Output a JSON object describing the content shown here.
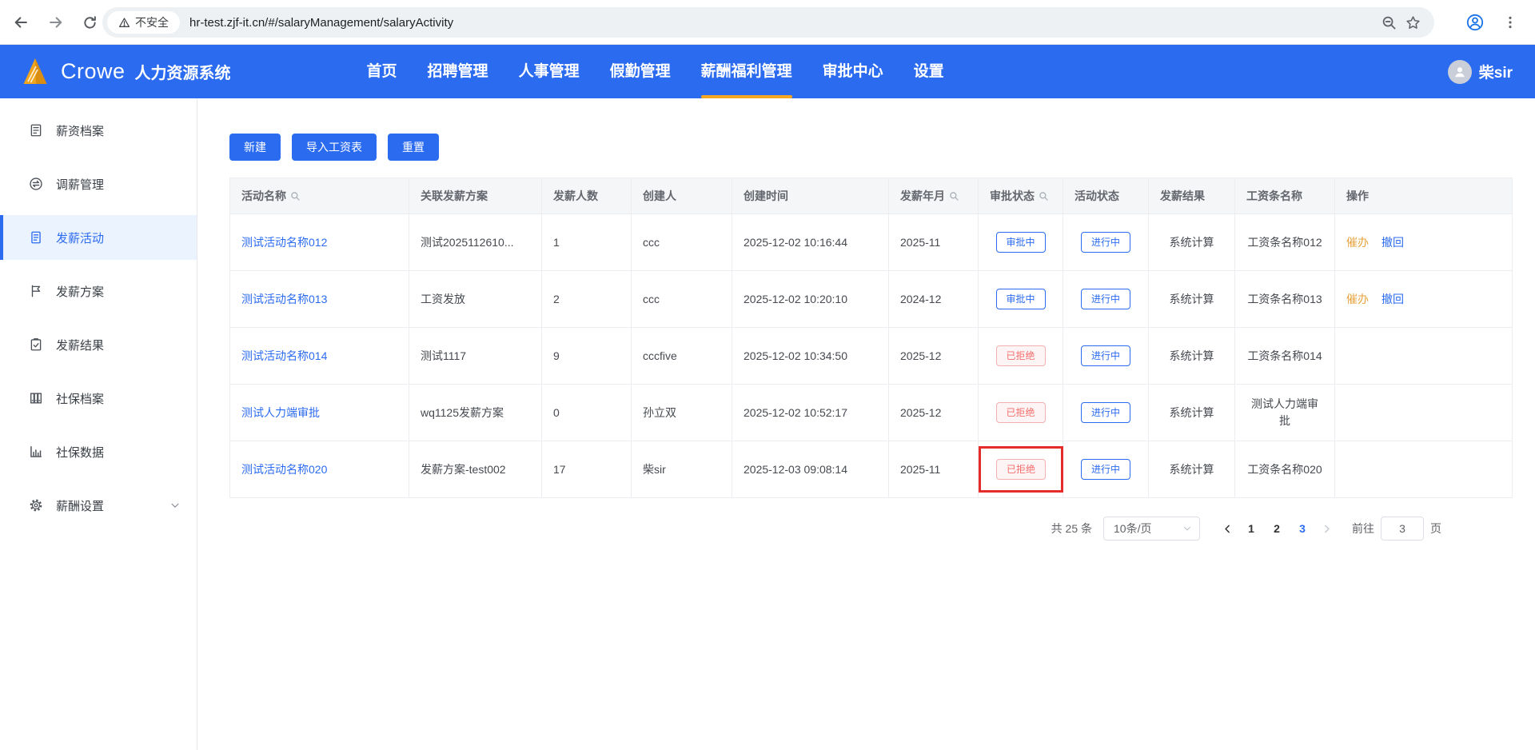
{
  "browser": {
    "security_label": "不安全",
    "url": "hr-test.zjf-it.cn/#/salaryManagement/salaryActivity"
  },
  "header": {
    "brand": "Crowe",
    "app_title": "人力资源系统",
    "user_name": "柴sir",
    "nav_items": [
      {
        "label": "首页",
        "active": false
      },
      {
        "label": "招聘管理",
        "active": false
      },
      {
        "label": "人事管理",
        "active": false
      },
      {
        "label": "假勤管理",
        "active": false
      },
      {
        "label": "薪酬福利管理",
        "active": true
      },
      {
        "label": "审批中心",
        "active": false
      },
      {
        "label": "设置",
        "active": false
      }
    ]
  },
  "sidebar": {
    "items": [
      {
        "label": "薪资档案",
        "active": false
      },
      {
        "label": "调薪管理",
        "active": false
      },
      {
        "label": "发薪活动",
        "active": true
      },
      {
        "label": "发薪方案",
        "active": false
      },
      {
        "label": "发薪结果",
        "active": false
      },
      {
        "label": "社保档案",
        "active": false
      },
      {
        "label": "社保数据",
        "active": false
      },
      {
        "label": "薪酬设置",
        "active": false
      }
    ]
  },
  "toolbar": {
    "create_label": "新建",
    "import_label": "导入工资表",
    "reset_label": "重置"
  },
  "table": {
    "columns": [
      {
        "label": "活动名称",
        "searchable": true
      },
      {
        "label": "关联发薪方案",
        "searchable": false
      },
      {
        "label": "发薪人数",
        "searchable": false
      },
      {
        "label": "创建人",
        "searchable": false
      },
      {
        "label": "创建时间",
        "searchable": false
      },
      {
        "label": "发薪年月",
        "searchable": true
      },
      {
        "label": "审批状态",
        "searchable": true
      },
      {
        "label": "活动状态",
        "searchable": false
      },
      {
        "label": "发薪结果",
        "searchable": false
      },
      {
        "label": "工资条名称",
        "searchable": false
      },
      {
        "label": "操作",
        "searchable": false
      }
    ],
    "rows": [
      {
        "name": "测试活动名称012",
        "plan": "测试2025112610...",
        "count": "1",
        "creator": "ccc",
        "created_at": "2025-12-02 10:16:44",
        "month": "2025-11",
        "approval": {
          "label": "审批中",
          "type": "processing"
        },
        "activity": {
          "label": "进行中",
          "type": "processing"
        },
        "result": "系统计算",
        "slip": "工资条名称012",
        "action_urge": "催办",
        "action_withdraw": "撤回"
      },
      {
        "name": "测试活动名称013",
        "plan": "工资发放",
        "count": "2",
        "creator": "ccc",
        "created_at": "2025-12-02 10:20:10",
        "month": "2024-12",
        "approval": {
          "label": "审批中",
          "type": "processing"
        },
        "activity": {
          "label": "进行中",
          "type": "processing"
        },
        "result": "系统计算",
        "slip": "工资条名称013",
        "action_urge": "催办",
        "action_withdraw": "撤回"
      },
      {
        "name": "测试活动名称014",
        "plan": "测试1117",
        "count": "9",
        "creator": "cccfive",
        "created_at": "2025-12-02 10:34:50",
        "month": "2025-12",
        "approval": {
          "label": "已拒绝",
          "type": "rejected"
        },
        "activity": {
          "label": "进行中",
          "type": "processing"
        },
        "result": "系统计算",
        "slip": "工资条名称014"
      },
      {
        "name": "测试人力端审批",
        "plan": "wq1125发薪方案",
        "count": "0",
        "creator": "孙立双",
        "created_at": "2025-12-02 10:52:17",
        "month": "2025-12",
        "approval": {
          "label": "已拒绝",
          "type": "rejected"
        },
        "activity": {
          "label": "进行中",
          "type": "processing"
        },
        "result": "系统计算",
        "slip": "测试人力端审批"
      },
      {
        "name": "测试活动名称020",
        "plan": "发薪方案-test002",
        "count": "17",
        "creator": "柴sir",
        "created_at": "2025-12-03 09:08:14",
        "month": "2025-11",
        "approval": {
          "label": "已拒绝",
          "type": "rejected"
        },
        "activity": {
          "label": "进行中",
          "type": "processing"
        },
        "result": "系统计算",
        "slip": "工资条名称020"
      }
    ]
  },
  "pagination": {
    "total_label": "共 25 条",
    "page_size_label": "10条/页",
    "pages": [
      "1",
      "2",
      "3"
    ],
    "active_page": "3",
    "goto_label": "前往",
    "goto_value": "3",
    "goto_suffix": "页"
  }
}
